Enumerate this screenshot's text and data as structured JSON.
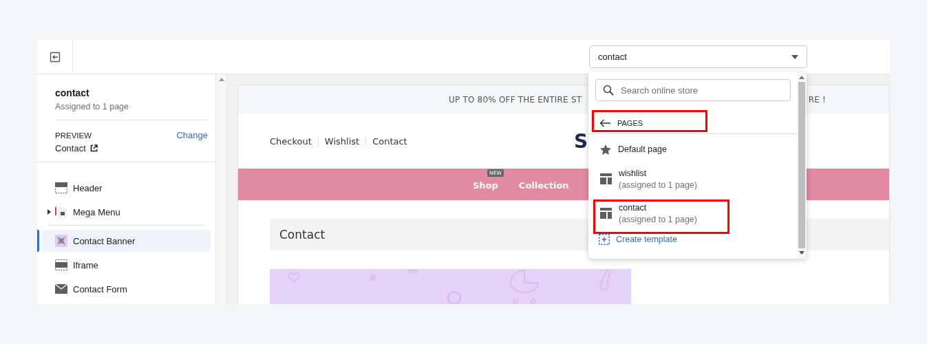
{
  "topbar": {
    "select": {
      "value": "contact"
    }
  },
  "sidebar": {
    "template": {
      "name": "contact",
      "assigned": "Assigned to 1 page"
    },
    "preview": {
      "label": "PREVIEW",
      "change": "Change",
      "page": "Contact"
    },
    "section_groups": [
      [
        {
          "label": "Header",
          "kind": "header",
          "selected": false,
          "expandable": false
        },
        {
          "label": "Mega Menu",
          "kind": "menu",
          "selected": false,
          "expandable": true
        }
      ],
      [
        {
          "label": "Contact Banner",
          "kind": "banner",
          "selected": true,
          "expandable": false
        },
        {
          "label": "Iframe",
          "kind": "iframe",
          "selected": false,
          "expandable": false
        },
        {
          "label": "Contact Form",
          "kind": "form",
          "selected": false,
          "expandable": false
        }
      ]
    ]
  },
  "preview": {
    "announcement": [
      "UP TO 80% OFF THE ENTIRE ST",
      "RE !"
    ],
    "top_links": [
      "Checkout",
      "Wishlist",
      "Contact"
    ],
    "logo": "S",
    "nav": [
      {
        "label": "Shop",
        "badge": "NEW"
      },
      {
        "label": "Collection"
      }
    ],
    "page_title": "Contact",
    "banner": {
      "kind": "picture"
    }
  },
  "dropdown": {
    "search": {
      "placeholder": "Search online store"
    },
    "back": {
      "label": "PAGES",
      "highlighted": true
    },
    "items": [
      {
        "kind": "default",
        "title": "Default page",
        "highlighted": false
      },
      {
        "kind": "template",
        "title": "wishlist",
        "subtitle": "(assigned to 1 page)",
        "highlighted": false
      },
      {
        "kind": "template",
        "title": "contact",
        "subtitle": "(assigned to 1 page)",
        "highlighted": true
      }
    ],
    "create": "Create template"
  }
}
